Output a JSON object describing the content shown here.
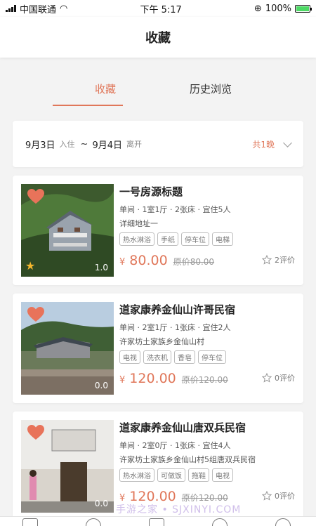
{
  "status_bar": {
    "carrier": "中国联通",
    "time": "下午 5:17",
    "battery": "100%"
  },
  "nav": {
    "title": "收藏"
  },
  "tabs": [
    {
      "label": "收藏",
      "active": true
    },
    {
      "label": "历史浏览",
      "active": false
    }
  ],
  "date_filter": {
    "checkin_date": "9月3日",
    "checkin_label": "入住",
    "sep": "~",
    "checkout_date": "9月4日",
    "checkout_label": "离开",
    "nights": "共1晚"
  },
  "listings": [
    {
      "title": "一号房源标题",
      "meta": "单间 · 1室1厅 · 2张床 · 宜住5人",
      "address": "详细地址一",
      "tags": [
        "热水淋浴",
        "手纸",
        "停车位",
        "电梯"
      ],
      "currency": "¥",
      "price": "80.00",
      "original_price": "原价80.00",
      "reviews": "2评价",
      "score": "1.0",
      "starred": true
    },
    {
      "title": "道家康养金仙山许哥民宿",
      "meta": "单间 · 2室1厅 · 1张床 · 宜住2人",
      "address": "许家坊土家族乡金仙山村",
      "tags": [
        "电视",
        "洗衣机",
        "香皂",
        "停车位"
      ],
      "currency": "¥",
      "price": "120.00",
      "original_price": "原价120.00",
      "reviews": "0评价",
      "score": "0.0",
      "starred": false
    },
    {
      "title": "道家康养金仙山唐双兵民宿",
      "meta": "单间 · 2室0厅 · 1张床 · 宜住4人",
      "address": "许家坊土家族乡金仙山村5组唐双兵民宿",
      "tags": [
        "热水淋浴",
        "可做饭",
        "拖鞋",
        "电视"
      ],
      "currency": "¥",
      "price": "120.00",
      "original_price": "原价120.00",
      "reviews": "0评价",
      "score": "0.0",
      "starred": false
    }
  ],
  "watermark": "手游之家 • SJXINYI.COM",
  "colors": {
    "accent": "#e0775a",
    "heart": "#e8735a",
    "star": "#f5b82e"
  }
}
